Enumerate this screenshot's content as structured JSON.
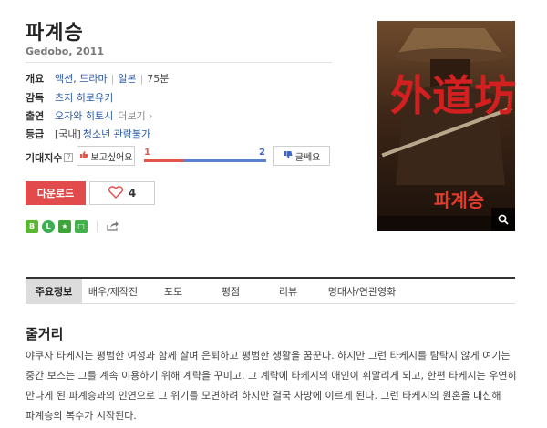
{
  "movie": {
    "title": "파계승",
    "subtitle": "Gedobo, 2011"
  },
  "info": {
    "overview": {
      "label": "개요",
      "genre": "액션, 드라마",
      "country": "일본",
      "runtime": "75분"
    },
    "director": {
      "label": "감독",
      "name": "츠지 히로유키"
    },
    "cast": {
      "label": "출연",
      "name": "오자와 히토시",
      "more": "더보기"
    },
    "rating": {
      "label": "등급",
      "region": "[국내]",
      "grade": "청소년 관람불가"
    }
  },
  "expectation": {
    "label": "기대지수",
    "help": "?",
    "want_label": "보고싶어요",
    "want_count": "1",
    "notwant_label": "글쎄요",
    "notwant_count": "2",
    "want_color": "#e2574c",
    "notwant_color": "#5a82cf",
    "want_fraction": 0.33
  },
  "actions": {
    "download_label": "다운로드",
    "like_count": "4"
  },
  "poster": {
    "calligraphy": "外道坊",
    "korean_title": "파계승"
  },
  "tabs": [
    {
      "label": "주요정보",
      "active": true
    },
    {
      "label": "배우/제작진",
      "active": false
    },
    {
      "label": "포토",
      "active": false
    },
    {
      "label": "평점",
      "active": false
    },
    {
      "label": "리뷰",
      "active": false
    },
    {
      "label": "명대사/연관영화",
      "active": false
    }
  ],
  "synopsis": {
    "title": "줄거리",
    "text": "야쿠자 타케시는 평범한 여성과 함께 살며 은퇴하고 평범한 생활을 꿈꾼다. 하지만 그런 타케시를 탐탁지 않게 여기는 중간 보스는 그를 계속 이용하기 위해 계략을 꾸미고, 그 계략에 타케시의 애인이 휘말리게 되고, 한편 타케시는 우연히 만나게 된 파계승과의 인연으로 그 위기를 모면하려 하지만 결국 사망에 이르게 된다. 그런 타케시의 원혼을 대신해 파계승의 복수가 시작된다."
  }
}
